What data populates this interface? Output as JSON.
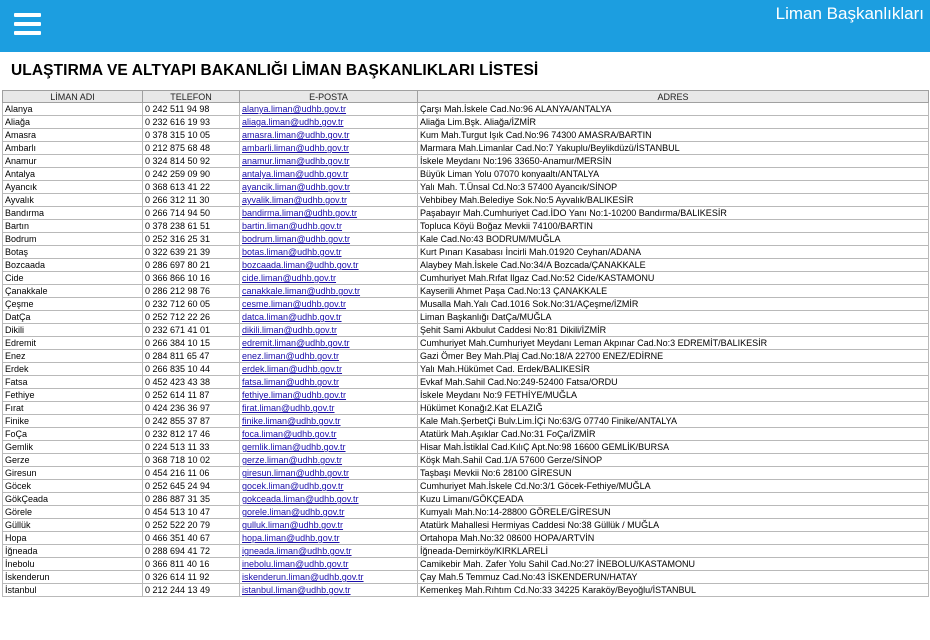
{
  "header": {
    "title": "Liman Başkanlıkları"
  },
  "page": {
    "heading": "ULAŞTIRMA VE ALTYAPI BAKANLIĞI LİMAN BAŞKANLIKLARI LİSTESİ"
  },
  "table": {
    "columns": [
      "LİMAN ADI",
      "TELEFON",
      "E-POSTA",
      "ADRES"
    ],
    "rows": [
      [
        "Alanya",
        "0 242 511 94 98",
        "alanya.liman@udhb.gov.tr",
        "Çarşı Mah.İskele Cad.No:96 ALANYA/ANTALYA"
      ],
      [
        "Aliağa",
        "0 232 616 19 93",
        "aliaga.liman@udhb.gov.tr",
        "Aliağa Lim.Bşk. Aliağa/İZMİR"
      ],
      [
        "Amasra",
        "0 378 315 10 05",
        "amasra.liman@udhb.gov.tr",
        "Kum Mah.Turgut Işık Cad.No:96 74300 AMASRA/BARTIN"
      ],
      [
        "Ambarlı",
        "0 212 875 68 48",
        "ambarli.liman@udhb.gov.tr",
        "Marmara Mah.Limanlar Cad.No:7 Yakuplu/Beylikdüzü/İSTANBUL"
      ],
      [
        "Anamur",
        "0 324 814 50 92",
        "anamur.liman@udhb.gov.tr",
        "İskele Meydanı No:196 33650-Anamur/MERSİN"
      ],
      [
        "Antalya",
        "0 242 259 09 90",
        "antalya.liman@udhb.gov.tr",
        "Büyük Liman Yolu 07070 konyaaltı/ANTALYA"
      ],
      [
        "Ayancık",
        "0 368 613 41 22",
        "ayancik.liman@udhb.gov.tr",
        "Yalı Mah. T.Ünsal Cd.No:3 57400 Ayancık/SİNOP"
      ],
      [
        "Ayvalık",
        "0 266 312 11 30",
        "ayvalik.liman@udhb.gov.tr",
        "Vehbibey Mah.Belediye Sok.No:5 Ayvalık/BALIKESİR"
      ],
      [
        "Bandırma",
        "0 266 714 94 50",
        "bandirma.liman@udhb.gov.tr",
        "Paşabayır Mah.Cumhuriyet Cad.İDO Yanı No:1-10200 Bandırma/BALIKESİR"
      ],
      [
        "Bartın",
        "0 378 238 61 51",
        "bartin.liman@udhb.gov.tr",
        "Topluca Köyü Boğaz Mevkii 74100/BARTIN"
      ],
      [
        "Bodrum",
        "0 252 316 25 31",
        "bodrum.liman@udhb.gov.tr",
        "Kale Cad.No:43 BODRUM/MUĞLA"
      ],
      [
        "Botaş",
        "0 322 639 21 39",
        "botas.liman@udhb.gov.tr",
        "Kurt Pınarı Kasabası İncirli Mah.01920 Ceyhan/ADANA"
      ],
      [
        "Bozcaada",
        "0 286 697 80 21",
        "bozcaada.liman@udhb.gov.tr",
        "Alaybey Mah.İskele Cad.No:34/A Bozcada/ÇANAKKALE"
      ],
      [
        "Cide",
        "0 366 866 10 16",
        "cide.liman@udhb.gov.tr",
        "Cumhuriyet Mah.Rıfat Ilgaz Cad.No:52 Cide/KASTAMONU"
      ],
      [
        "Çanakkale",
        "0 286 212 98 76",
        "canakkale.liman@udhb.gov.tr",
        "Kayserili Ahmet Paşa Cad.No:13 ÇANAKKALE"
      ],
      [
        "Çeşme",
        "0 232 712 60 05",
        "cesme.liman@udhb.gov.tr",
        "Musalla Mah.Yalı Cad.1016 Sok.No:31/AÇeşme/İZMİR"
      ],
      [
        "DatÇa",
        "0 252 712 22 26",
        "datca.liman@udhb.gov.tr",
        "Liman Başkanlığı DatÇa/MUĞLA"
      ],
      [
        "Dikili",
        "0 232 671 41 01",
        "dikili.liman@udhb.gov.tr",
        "Şehit Sami Akbulut Caddesi No:81 Dikili/İZMİR"
      ],
      [
        "Edremit",
        "0 266 384 10 15",
        "edremit.liman@udhb.gov.tr",
        "Cumhuriyet Mah.Cumhuriyet Meydanı Leman Akpınar Cad.No:3 EDREMİT/BALIKESİR"
      ],
      [
        "Enez",
        "0 284 811 65 47",
        "enez.liman@udhb.gov.tr",
        "Gazi Ömer Bey Mah.Plaj Cad.No:18/A 22700 ENEZ/EDİRNE"
      ],
      [
        "Erdek",
        "0 266 835 10 44",
        "erdek.liman@udhb.gov.tr",
        "Yalı Mah.Hükümet Cad. Erdek/BALIKESİR"
      ],
      [
        "Fatsa",
        "0 452 423 43 38",
        "fatsa.liman@udhb.gov.tr",
        "Evkaf Mah.Sahil Cad.No:249-52400 Fatsa/ORDU"
      ],
      [
        "Fethiye",
        "0 252 614 11 87",
        "fethiye.liman@udhb.gov.tr",
        "İskele Meydanı No:9 FETHİYE/MUĞLA"
      ],
      [
        "Fırat",
        "0 424 236 36 97",
        "firat.liman@udhb.gov.tr",
        "Hükümet Konağı2.Kat ELAZIĞ"
      ],
      [
        "Finike",
        "0 242 855 37 87",
        "finike.liman@udhb.gov.tr",
        "Kale Mah.ŞerbetÇi Bulv.Lim.İÇi No:63/G 07740 Finike/ANTALYA"
      ],
      [
        "FoÇa",
        "0 232 812 17 46",
        "foca.liman@udhb.gov.tr",
        "Atatürk Mah.Aşıklar Cad.No:31 FoÇa/İZMİR"
      ],
      [
        "Gemlik",
        "0 224 513 11 33",
        "gemlik.liman@udhb.gov.tr",
        "Hisar Mah.İstiklal Cad.KılıÇ Apt.No:98 16600 GEMLİK/BURSA"
      ],
      [
        "Gerze",
        "0 368 718 10 02",
        "gerze.liman@udhb.gov.tr",
        "Köşk Mah.Sahil Cad.1/A 57600 Gerze/SİNOP"
      ],
      [
        "Giresun",
        "0 454 216 11 06",
        "giresun.liman@udhb.gov.tr",
        "Taşbaşı Mevkii No:6 28100 GİRESUN"
      ],
      [
        "Göcek",
        "0 252 645 24 94",
        "gocek.liman@udhb.gov.tr",
        "Cumhuriyet Mah.İskele Cd.No:3/1 Göcek-Fethiye/MUĞLA"
      ],
      [
        "GökÇeada",
        "0 286 887 31 35",
        "gokceada.liman@udhb.gov.tr",
        "Kuzu Limanı/GÖKÇEADA"
      ],
      [
        "Görele",
        "0 454 513 10 47",
        "gorele.liman@udhb.gov.tr",
        "Kumyalı Mah.No:14-28800 GÖRELE/GİRESUN"
      ],
      [
        "Güllük",
        "0 252 522 20 79",
        "gulluk.liman@udhb.gov.tr",
        "Atatürk Mahallesi Hermiyas Caddesi No:38 Güllük / MUĞLA"
      ],
      [
        "Hopa",
        "0 466 351 40 67",
        "hopa.liman@udhb.gov.tr",
        "Ortahopa Mah.No:32 08600 HOPA/ARTVİN"
      ],
      [
        "İğneada",
        "0 288 694 41 72",
        "igneada.liman@udhb.gov.tr",
        "İğneada-Demirköy/KIRKLARELİ"
      ],
      [
        "İnebolu",
        "0 366 811 40 16",
        "inebolu.liman@udhb.gov.tr",
        "Camikebir Mah. Zafer Yolu Sahil Cad.No:27 İNEBOLU/KASTAMONU"
      ],
      [
        "İskenderun",
        "0 326 614 11 92",
        "iskenderun.liman@udhb.gov.tr",
        "Çay Mah.5 Temmuz Cad.No:43 İSKENDERUN/HATAY"
      ],
      [
        "İstanbul",
        "0 212 244 13 49",
        "istanbul.liman@udhb.gov.tr",
        "Kemenkeş Mah.Rıhtım Cd.No:33 34225 Karaköy/Beyoğlu/İSTANBUL"
      ]
    ]
  }
}
